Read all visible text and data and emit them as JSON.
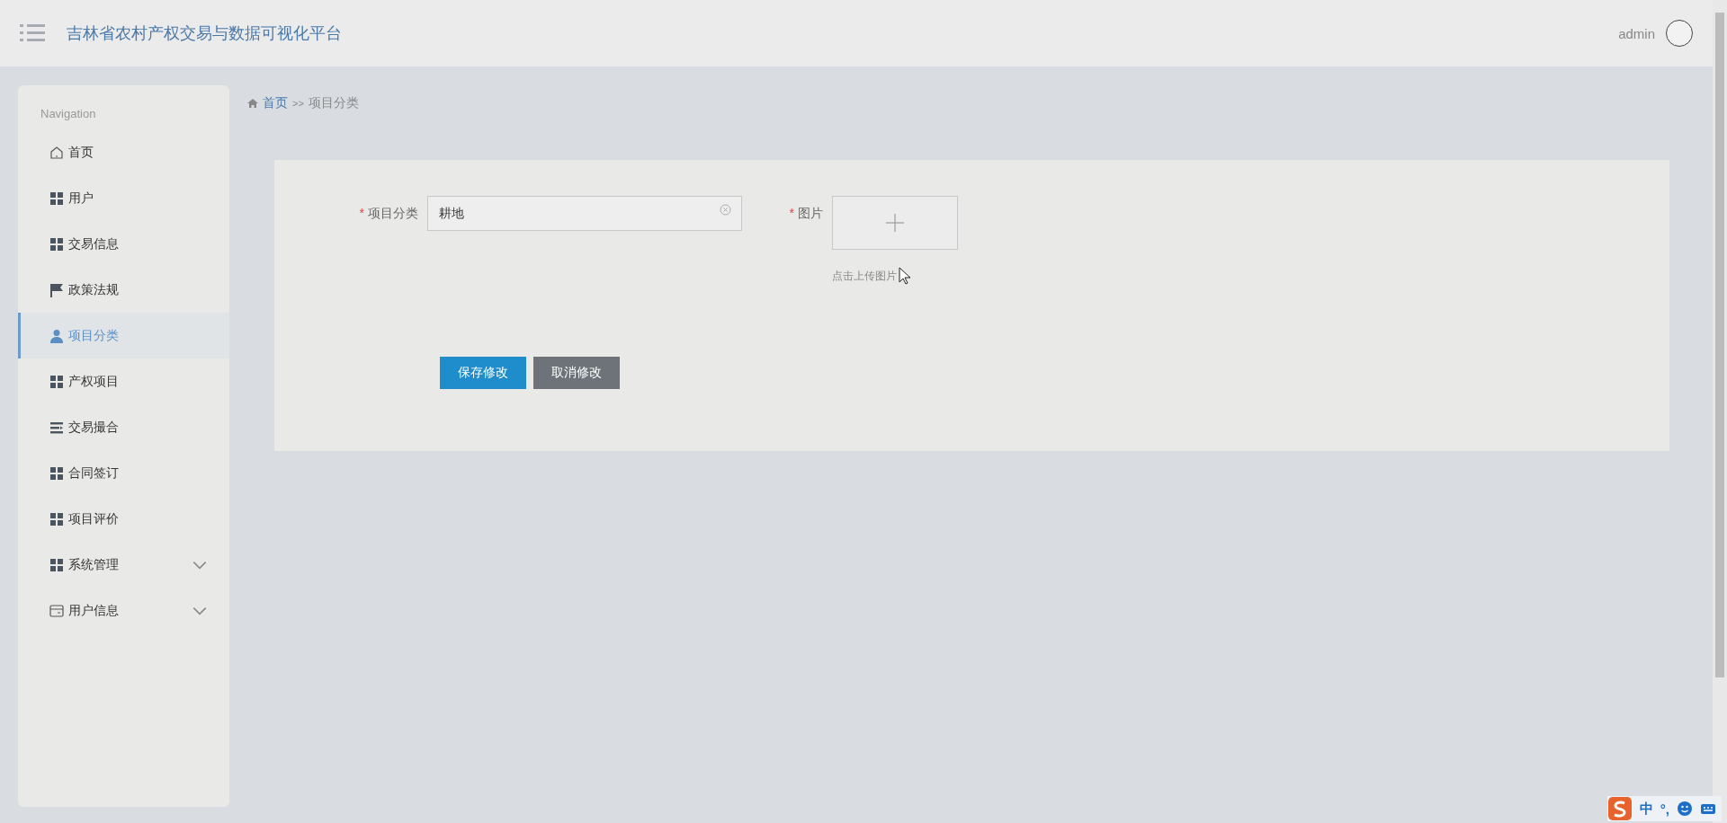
{
  "header": {
    "title": "吉林省农村产权交易与数据可视化平台",
    "username": "admin"
  },
  "sidebar": {
    "heading": "Navigation",
    "items": [
      {
        "label": "首页",
        "kind": "home",
        "selected": false
      },
      {
        "label": "用户",
        "kind": "grid",
        "selected": false
      },
      {
        "label": "交易信息",
        "kind": "grid",
        "selected": false
      },
      {
        "label": "政策法规",
        "kind": "flag",
        "selected": false
      },
      {
        "label": "项目分类",
        "kind": "person",
        "selected": true
      },
      {
        "label": "产权项目",
        "kind": "grid",
        "selected": false
      },
      {
        "label": "交易撮合",
        "kind": "lines",
        "selected": false
      },
      {
        "label": "合同签订",
        "kind": "grid",
        "selected": false
      },
      {
        "label": "项目评价",
        "kind": "grid",
        "selected": false
      },
      {
        "label": "系统管理",
        "kind": "grid",
        "selected": false,
        "expandable": true
      },
      {
        "label": "用户信息",
        "kind": "card",
        "selected": false,
        "expandable": true
      }
    ]
  },
  "breadcrumb": {
    "home": "首页",
    "separator": ">>",
    "current": "项目分类"
  },
  "form": {
    "category": {
      "required_mark": "*",
      "label": "项目分类",
      "value": "耕地"
    },
    "image": {
      "required_mark": "*",
      "label": "图片",
      "hint": "点击上传图片"
    },
    "buttons": [
      {
        "label": "保存修改",
        "kind": "primary"
      },
      {
        "label": "取消修改",
        "kind": "secondary"
      }
    ]
  },
  "ime_toolbar": {
    "mode": "中",
    "punctuation": "°,"
  }
}
